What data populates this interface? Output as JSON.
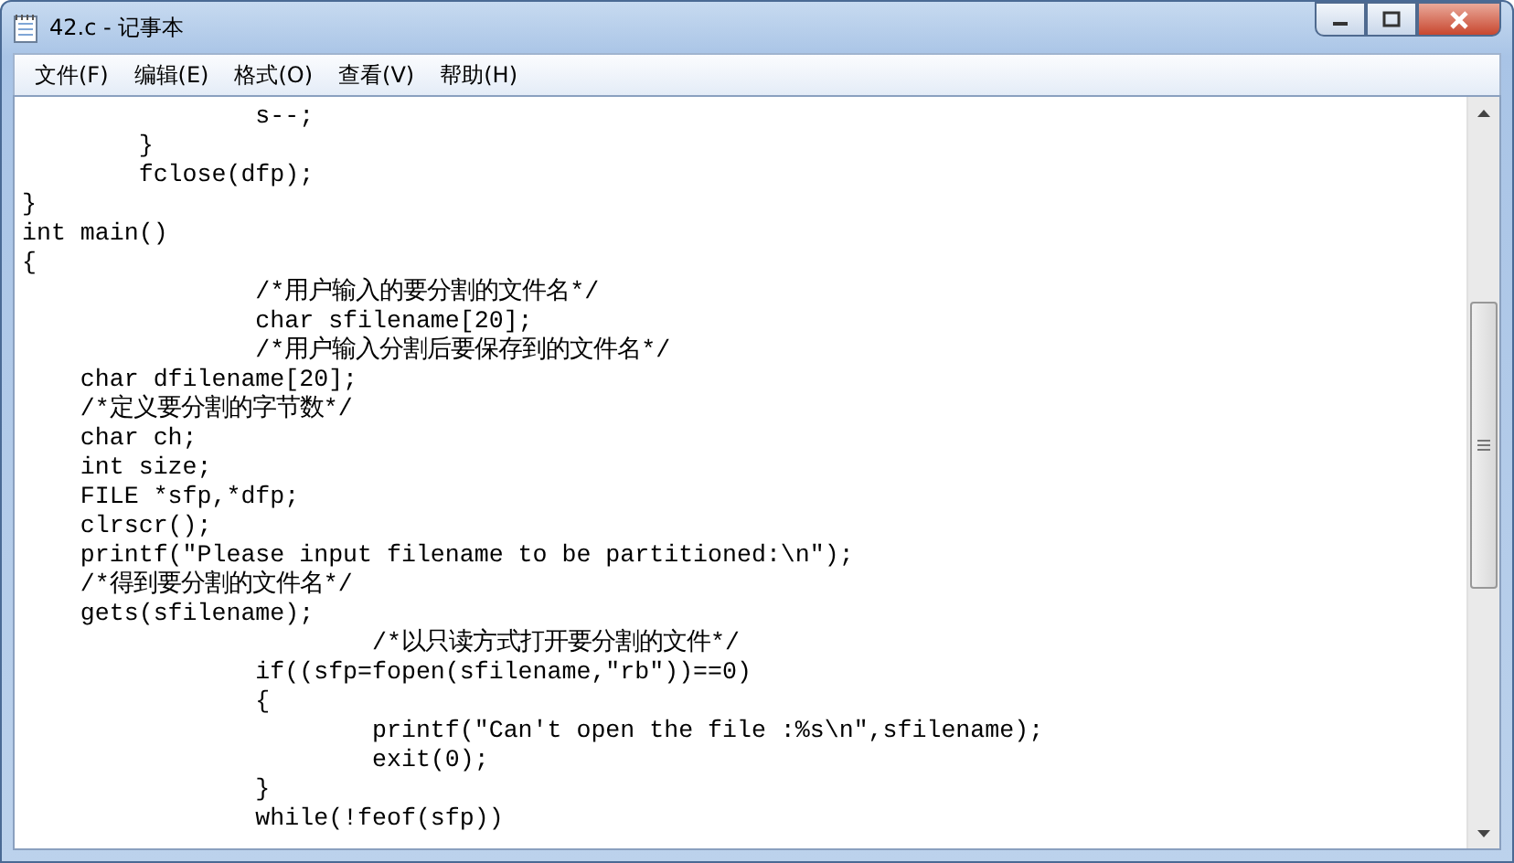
{
  "window": {
    "title": "42.c - 记事本"
  },
  "menu": [
    "文件(F)",
    "编辑(E)",
    "格式(O)",
    "查看(V)",
    "帮助(H)"
  ],
  "editor": {
    "lines": [
      "                s--;",
      "        }",
      "        fclose(dfp);",
      "}",
      "int main()",
      "{",
      "                /*用户输入的要分割的文件名*/",
      "                char sfilename[20];",
      "                /*用户输入分割后要保存到的文件名*/",
      "    char dfilename[20];",
      "    /*定义要分割的字节数*/",
      "    char ch;",
      "    int size;",
      "    FILE *sfp,*dfp;",
      "    clrscr();",
      "    printf(\"Please input filename to be partitioned:\\n\");",
      "    /*得到要分割的文件名*/",
      "    gets(sfilename);",
      "                        /*以只读方式打开要分割的文件*/",
      "                if((sfp=fopen(sfilename,\"rb\"))==0)",
      "                {",
      "                        printf(\"Can't open the file :%s\\n\",sfilename);",
      "                        exit(0);",
      "                }",
      "                while(!feof(sfp))"
    ]
  }
}
